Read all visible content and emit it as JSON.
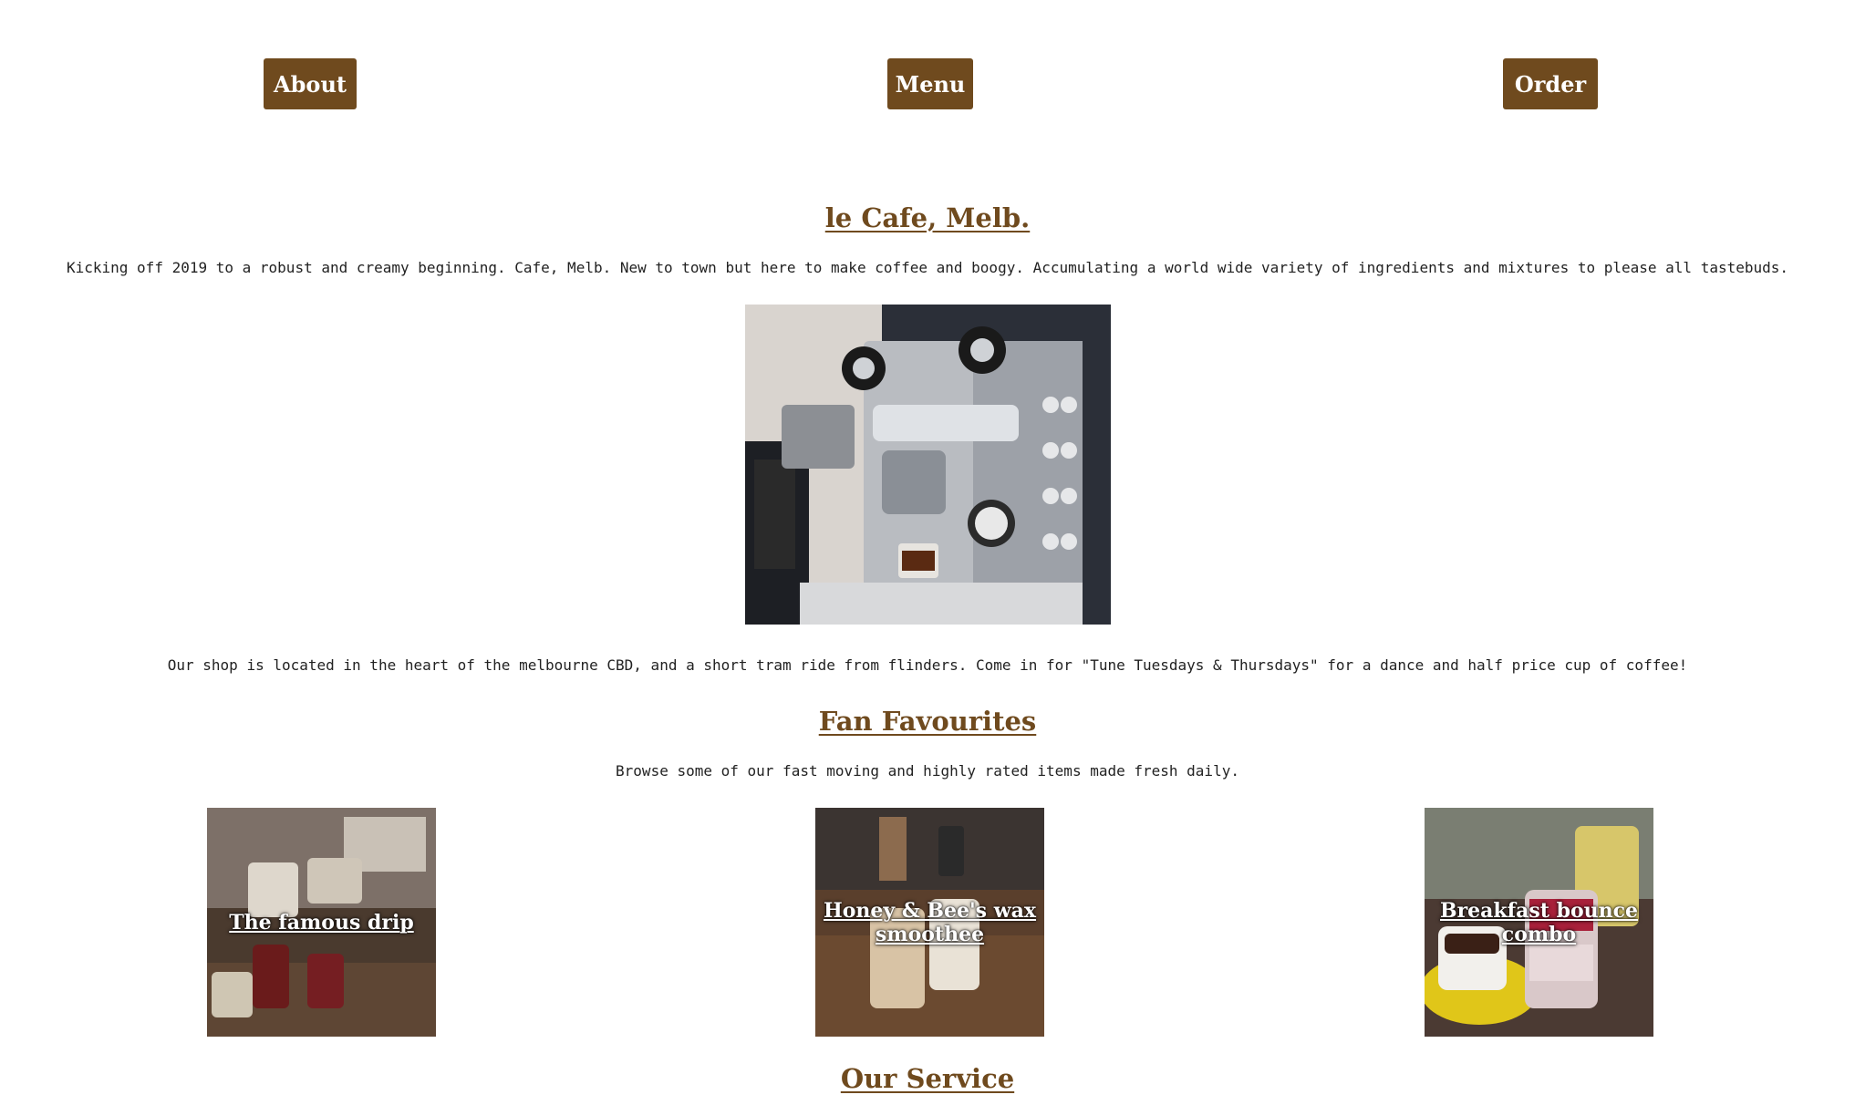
{
  "nav": {
    "about_label": "About",
    "menu_label": "Menu",
    "order_label": "Order"
  },
  "intro": {
    "title": "le Cafe, Melb.",
    "text": "Kicking off 2019 to a robust and creamy beginning. Cafe, Melb. New to town but here to make coffee and boogy. Accumulating a world wide variety of ingredients and mixtures to please all tastebuds.",
    "location_text": "Our shop is located in the heart of the melbourne CBD, and a short tram ride from flinders. Come in for \"Tune Tuesdays & Thursdays\" for a dance and half price cup of coffee!"
  },
  "favourites": {
    "title": "Fan Favourites",
    "text": "Browse some of our fast moving and highly rated items made fresh daily.",
    "items": [
      {
        "label": "The famous drip"
      },
      {
        "label": "Honey & Bee's wax smoothee"
      },
      {
        "label": "Breakfast bounce combo"
      }
    ]
  },
  "service": {
    "title": "Our Service"
  },
  "colors": {
    "accent": "#6f4a1e",
    "button_text": "#ffffff",
    "body_text": "#222222"
  }
}
